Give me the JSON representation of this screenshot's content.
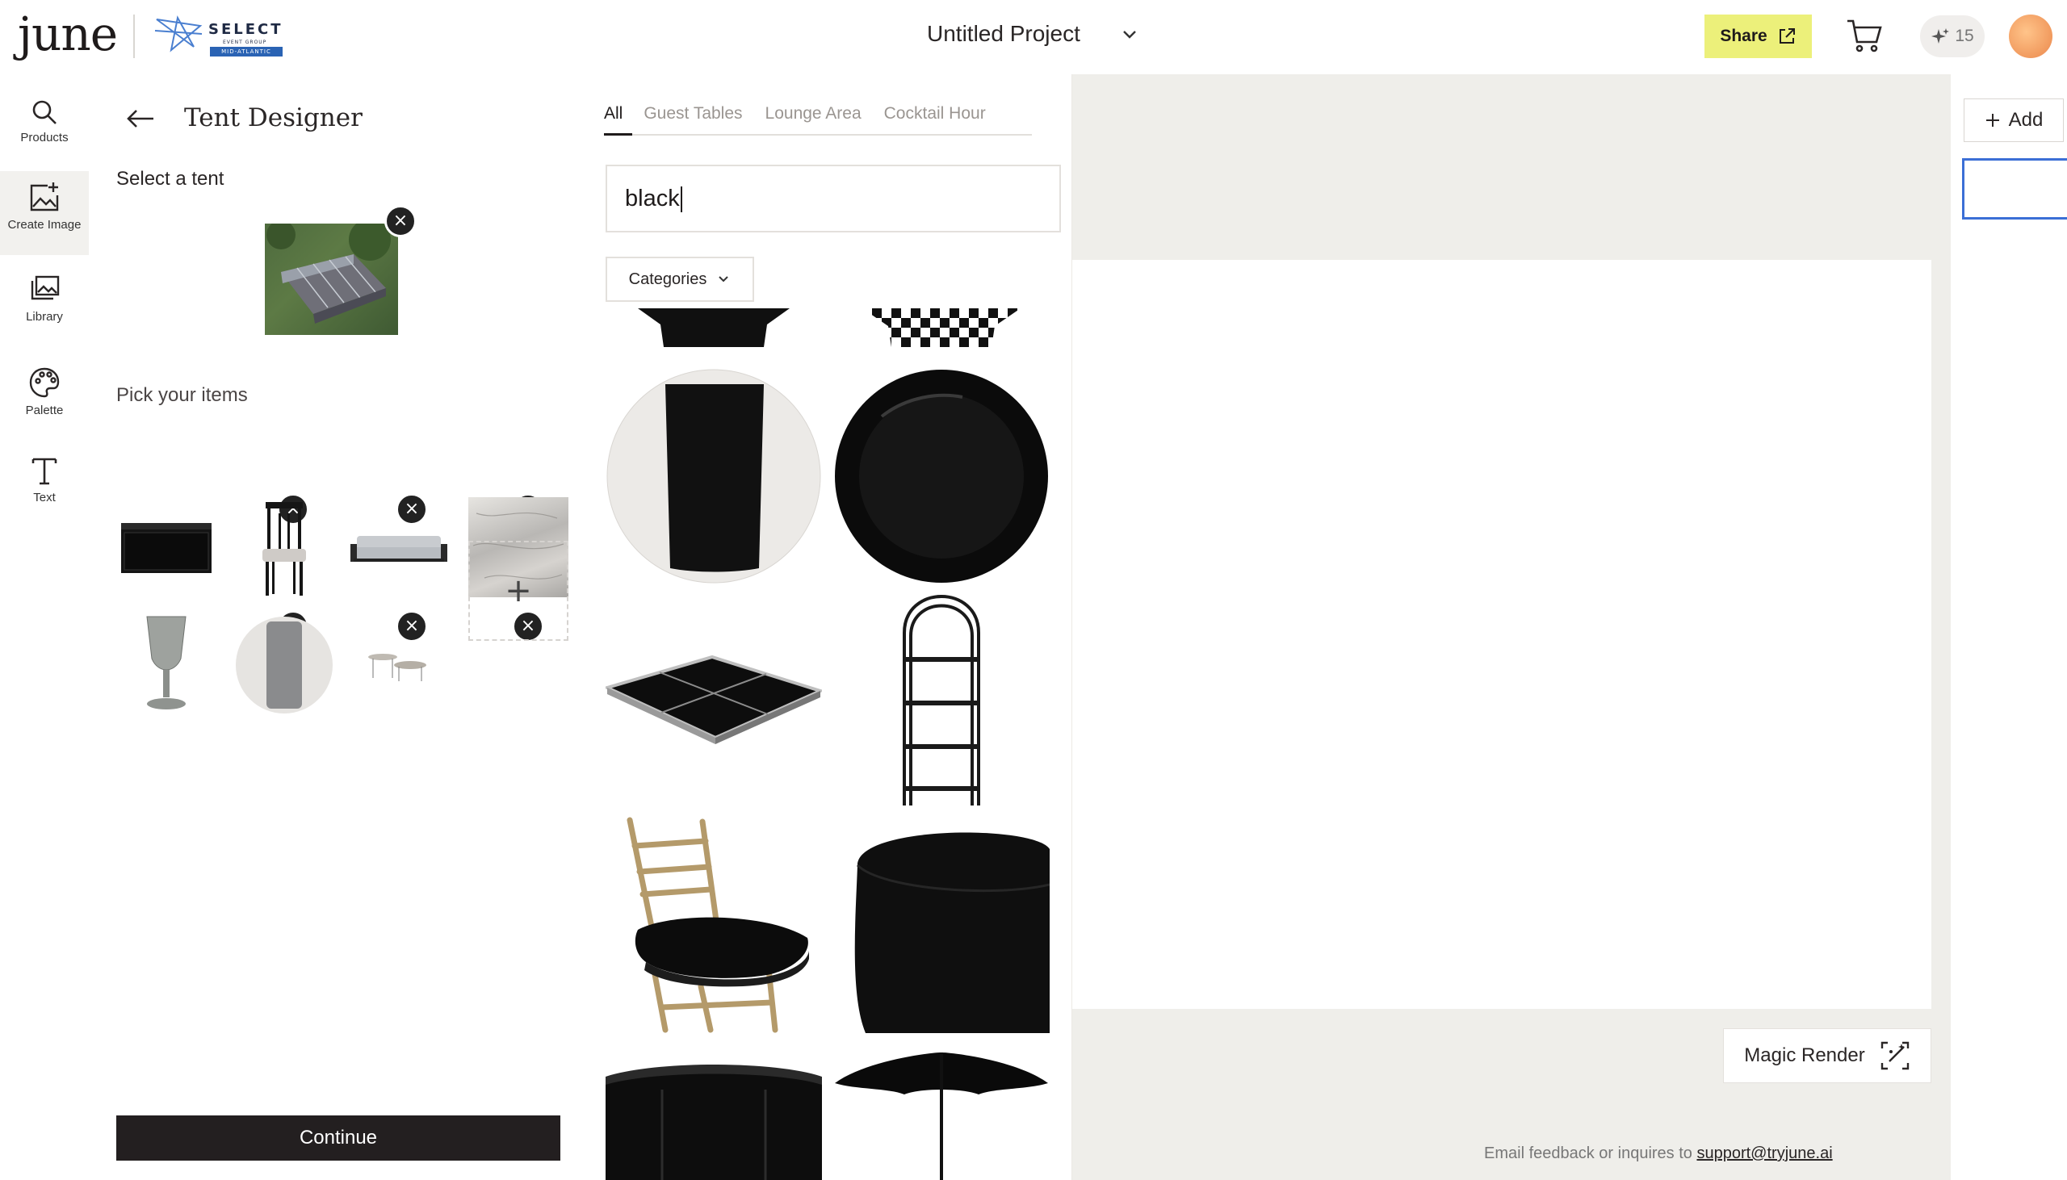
{
  "header": {
    "logo": "june",
    "brand": {
      "line1": "SELECT",
      "line2": "EVENT GROUP",
      "line3": "MID-ATLANTIC"
    },
    "project_title": "Untitled Project",
    "share_label": "Share",
    "credits": "15"
  },
  "rail": {
    "items": [
      {
        "label": "Products",
        "icon": "search-icon"
      },
      {
        "label": "Create Image",
        "icon": "image-plus-icon"
      },
      {
        "label": "Library",
        "icon": "library-icon"
      },
      {
        "label": "Palette",
        "icon": "palette-icon"
      },
      {
        "label": "Text",
        "icon": "text-icon"
      }
    ]
  },
  "panel": {
    "title": "Tent Designer",
    "select_tent_label": "Select a tent",
    "pick_items_label": "Pick your items",
    "continue_label": "Continue",
    "items": [
      "black bar",
      "black chair",
      "sofa",
      "marble table",
      "goblet",
      "napkin plate",
      "side tables"
    ]
  },
  "search": {
    "tabs": [
      "All",
      "Guest Tables",
      "Lounge Area",
      "Cocktail Hour"
    ],
    "active_tab": "All",
    "query": "black",
    "categories_label": "Categories",
    "results": [
      "napkin",
      "buffalo check",
      "black napkin on plate",
      "black charger plate",
      "black dance floor",
      "black etagere shelf",
      "chiavari chair black cushion",
      "black round tablecloth",
      "black bar",
      "black umbrella"
    ]
  },
  "canvas": {
    "magic_render_label": "Magic Render",
    "feedback_text": "Email feedback or inquires to ",
    "feedback_email": "support@tryjune.ai"
  },
  "pages": {
    "add_label": "Add"
  },
  "colors": {
    "share_bg": "#ecf07a",
    "canvas_bg": "#efeeea",
    "continue_bg": "#231f20",
    "page_thumb_border": "#3b6fd6"
  }
}
